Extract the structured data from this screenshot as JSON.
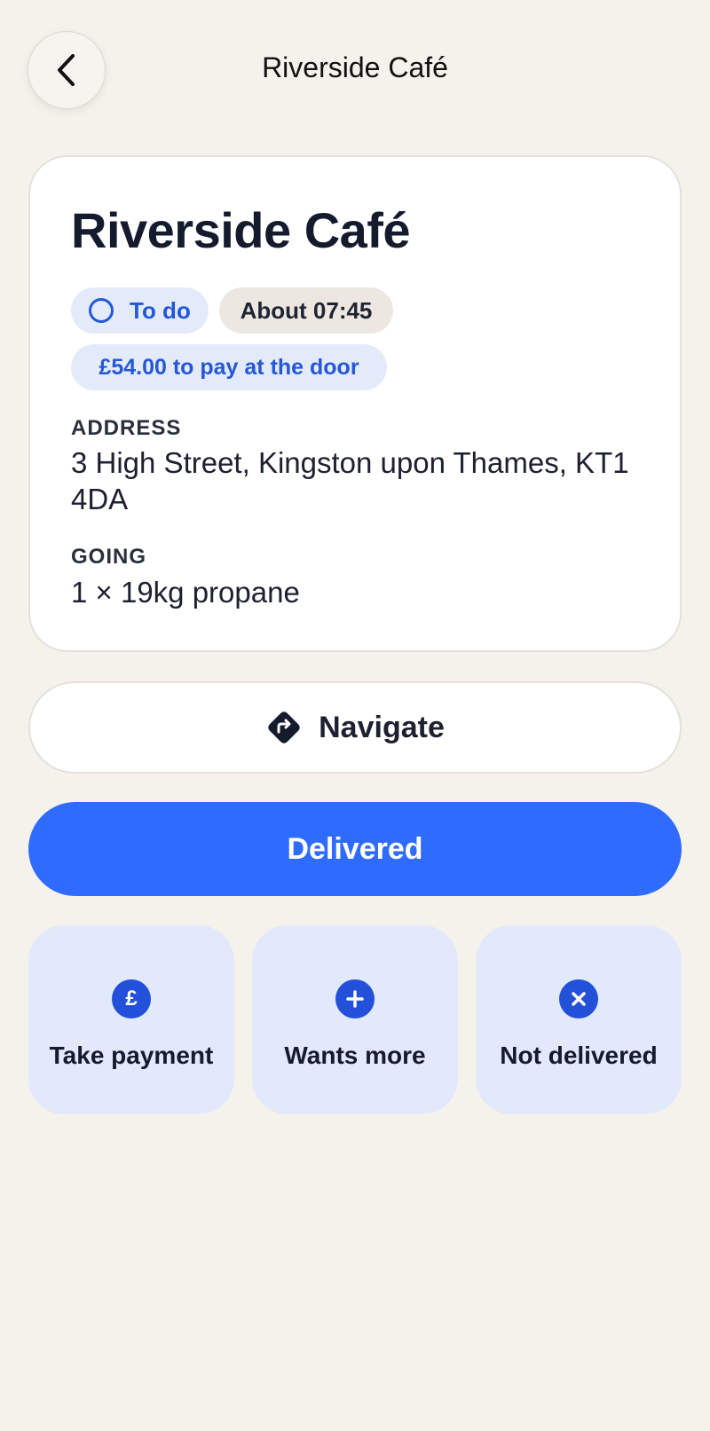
{
  "header": {
    "title": "Riverside Café",
    "back_icon": "chevron-left-icon"
  },
  "stop": {
    "name": "Riverside Café",
    "status": "To do",
    "eta": "About 07:45",
    "payment_note": "£54.00 to pay at the door",
    "address_label": "ADDRESS",
    "address": "3 High Street, Kingston upon Thames, KT1 4DA",
    "going_label": "GOING",
    "going": "1 × 19kg propane"
  },
  "actions": {
    "navigate_label": "Navigate",
    "navigate_icon": "directions-icon",
    "delivered_label": "Delivered",
    "tiles": [
      {
        "label": "Take payment",
        "icon": "pound-icon",
        "glyph": "£"
      },
      {
        "label": "Wants more",
        "icon": "plus-icon"
      },
      {
        "label": "Not delivered",
        "icon": "close-icon"
      }
    ]
  },
  "colors": {
    "background": "#f5f2ec",
    "primary": "#2f6bff",
    "accent_blue": "#2557d6",
    "tile_bg": "#e1e9fb",
    "status_pill_bg": "#e3ebfb",
    "time_pill_bg": "#ece8e1"
  }
}
